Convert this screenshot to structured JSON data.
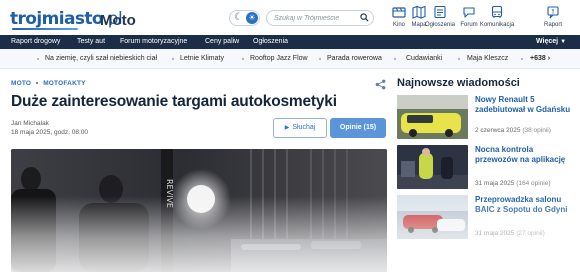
{
  "brand": {
    "logo_main": "trojmiasto",
    "logo_tail": ".pl",
    "section": "Moto"
  },
  "search": {
    "placeholder": "Szukaj w Trójmieście"
  },
  "services": [
    {
      "label": "Kino",
      "icon": "film-icon"
    },
    {
      "label": "Mapa",
      "icon": "map-icon"
    },
    {
      "label": "Ogłoszenia",
      "icon": "classifieds-icon"
    },
    {
      "label": "Forum",
      "icon": "chat-icon"
    },
    {
      "label": "Komunikacja",
      "icon": "bus-icon"
    },
    {
      "label": "Raport",
      "icon": "report-icon"
    }
  ],
  "nav": {
    "items": [
      "Raport drogowy",
      "Testy aut",
      "Forum motoryzacyjne",
      "Ceny paliw",
      "Ogłoszenia"
    ],
    "more": "Więcej"
  },
  "tags": {
    "items": [
      "Na ziemię, czyli szał niebieskich ciał",
      "Letnie Klimaty",
      "Rooftop Jazz Flow",
      "Parada rowerowa",
      "Cudawianki",
      "Maja Kleszcz"
    ],
    "count": "+638"
  },
  "article": {
    "breadcrumb": [
      "MOTO",
      "MOTOFAKTY"
    ],
    "title": "Duże zainteresowanie targami autokosmetyki",
    "author": "Jan Michalak",
    "date": "18 maja 2025, godz. 08:00",
    "listen_label": "Słuchaj",
    "comments_label": "Opinie (15)"
  },
  "sidebar": {
    "title": "Najnowsze wiadomości",
    "items": [
      {
        "title": "Nowy Renault 5 zadebiutował w Gdańsku",
        "date": "2 czerwca 2025",
        "count": "(38 opinii)"
      },
      {
        "title": "Nocna kontrola przewozów na aplikację",
        "date": "31 maja 2025",
        "count": "(164 opinie)"
      },
      {
        "title": "Przeprowadzka salonu BAIC z Sopotu do Gdyni",
        "date": "31 maja 2025",
        "count": "(27 opinii)"
      }
    ]
  },
  "colors": {
    "brand_blue": "#1f5fa8",
    "nav_dark": "#1c2e47",
    "accent_blue": "#2c6fc6",
    "button_blue": "#5b94d8"
  }
}
